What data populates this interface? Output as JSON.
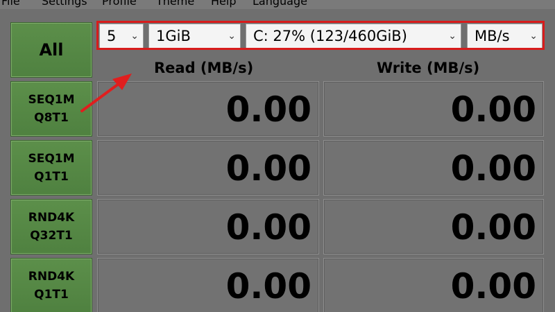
{
  "menu": {
    "file": "File",
    "settings": "Settings",
    "profile": "Profile",
    "theme": "Theme",
    "help": "Help",
    "language": "Language"
  },
  "toolbar": {
    "count": "5",
    "size": "1GiB",
    "drive": "C: 27% (123/460GiB)",
    "unit": "MB/s"
  },
  "buttons": {
    "all": "All",
    "tests": [
      {
        "line1": "SEQ1M",
        "line2": "Q8T1"
      },
      {
        "line1": "SEQ1M",
        "line2": "Q1T1"
      },
      {
        "line1": "RND4K",
        "line2": "Q32T1"
      },
      {
        "line1": "RND4K",
        "line2": "Q1T1"
      }
    ]
  },
  "headers": {
    "read": "Read (MB/s)",
    "write": "Write (MB/s)"
  },
  "results": [
    {
      "read": "0.00",
      "write": "0.00"
    },
    {
      "read": "0.00",
      "write": "0.00"
    },
    {
      "read": "0.00",
      "write": "0.00"
    },
    {
      "read": "0.00",
      "write": "0.00"
    }
  ],
  "colors": {
    "highlight": "#d81b1b",
    "button_green": "#5c8f4a",
    "background": "#6f6f6f"
  }
}
